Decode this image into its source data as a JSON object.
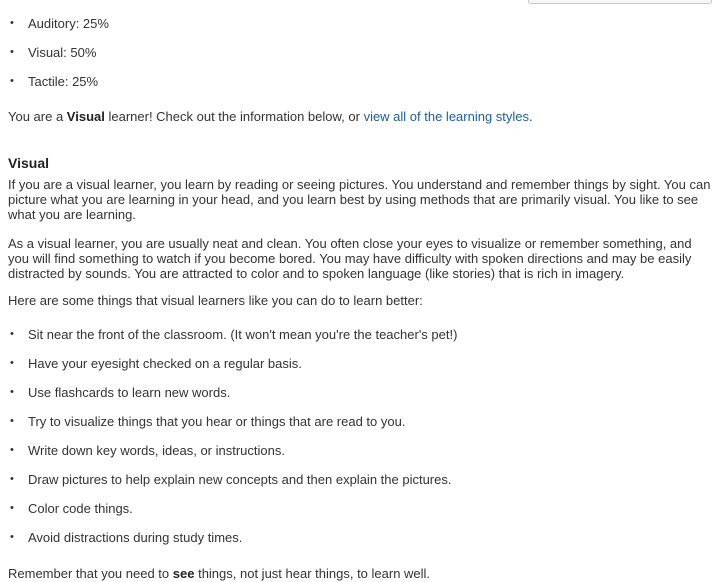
{
  "results": {
    "items": [
      {
        "label": "Auditory: 25%"
      },
      {
        "label": "Visual: 50%"
      },
      {
        "label": "Tactile: 25%"
      }
    ],
    "line_prefix": "You are a ",
    "learner_type": "Visual",
    "line_middle": " learner! Check out the information below, or ",
    "link_text": "view all of the learning styles",
    "line_suffix": "."
  },
  "section": {
    "title": "Visual",
    "para1": "If you are a visual learner, you learn by reading or seeing pictures. You understand and remember things by sight. You can picture what you are learning in your head, and you learn best by using methods that are primarily visual. You like to see what you are learning.",
    "para2": "As a visual learner, you are usually neat and clean. You often close your eyes to visualize or remember something, and you will find something to watch if you become bored. You may have difficulty with spoken directions and may be easily distracted by sounds. You are attracted to color and to spoken language (like stories) that is rich in imagery.",
    "para3": "Here are some things that visual learners like you can do to learn better:"
  },
  "tips": [
    {
      "label": "Sit near the front of the classroom. (It won't mean you're the teacher's pet!)"
    },
    {
      "label": "Have your eyesight checked on a regular basis."
    },
    {
      "label": "Use flashcards to learn new words."
    },
    {
      "label": "Try to visualize things that you hear or things that are read to you."
    },
    {
      "label": "Write down key words, ideas, or instructions."
    },
    {
      "label": "Draw pictures to help explain new concepts and then explain the pictures."
    },
    {
      "label": "Color code things."
    },
    {
      "label": "Avoid distractions during study times."
    }
  ],
  "closing": {
    "prefix": "Remember that you need to ",
    "emphasis": "see",
    "suffix": " things, not just hear things, to learn well."
  },
  "bullet_glyph": "•",
  "colors": {
    "text": "#333333",
    "link": "#1a5f9e"
  }
}
